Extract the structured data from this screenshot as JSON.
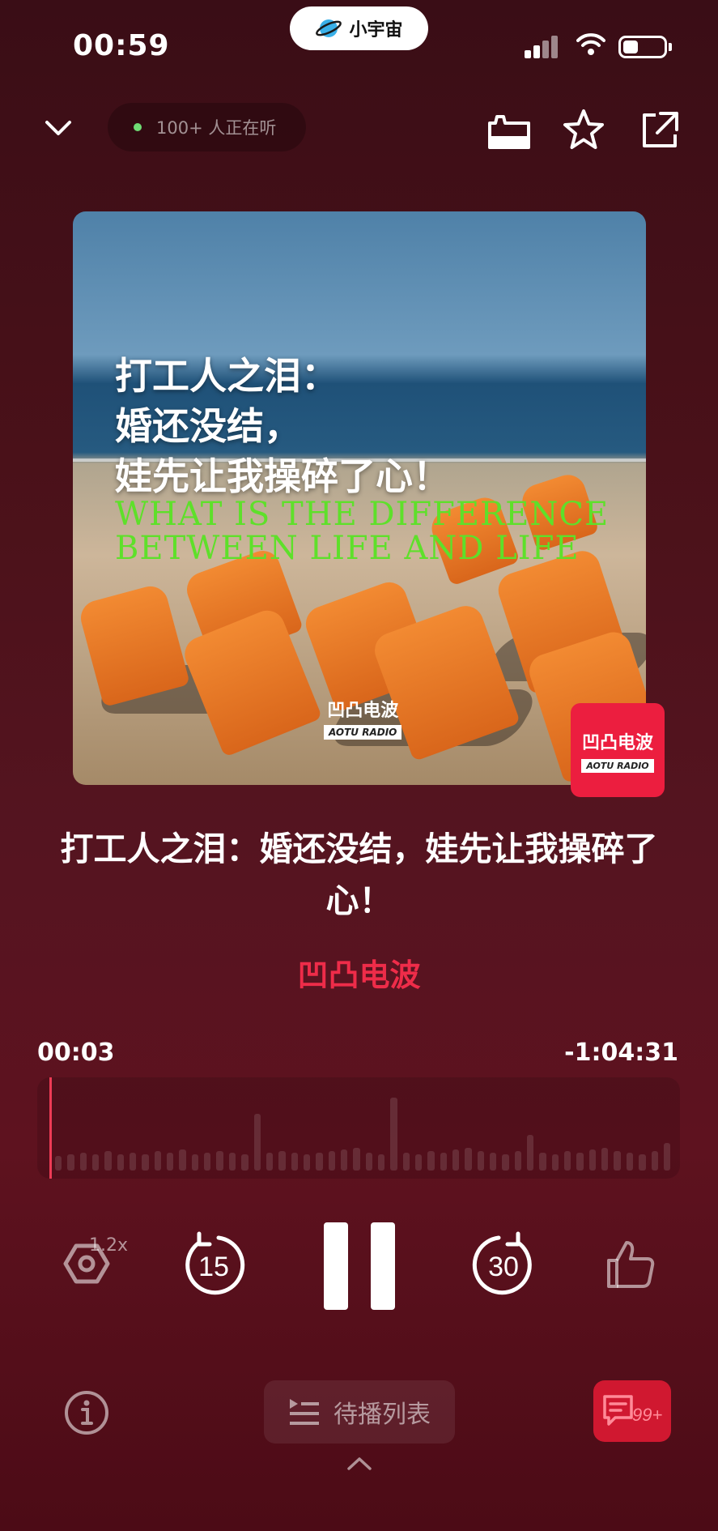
{
  "status_bar": {
    "time": "00:59",
    "app_island_label": "小宇宙",
    "battery_level": 0.3
  },
  "header": {
    "listeners_text": "100+ 人正在听",
    "collapse_icon": "chevron-down-icon",
    "icons": [
      "save-tray-icon",
      "star-icon",
      "share-icon"
    ]
  },
  "cover": {
    "title_lines": [
      "打工人之泪：",
      "婚还没结，",
      "娃先让我操碎了心！"
    ],
    "english_lines": [
      "WHAT IS THE DIFFERENCE",
      "BETWEEN LIFE AND LIFE"
    ],
    "logo_cn": "凹凸电波",
    "logo_en": "AOTU RADIO"
  },
  "badge": {
    "cn": "凹凸电波",
    "en": "AOTU RADIO"
  },
  "episode": {
    "title": "打工人之泪：婚还没结，娃先让我操碎了心！",
    "podcast": "凹凸电波"
  },
  "progress": {
    "current": "00:03",
    "remaining": "-1:04:31"
  },
  "controls": {
    "speed_label": "1.2x",
    "rewind_seconds": "15",
    "forward_seconds": "30",
    "state": "playing"
  },
  "bottom": {
    "queue_label": "待播列表",
    "comment_count": "99+"
  },
  "colors": {
    "accent": "#ee2c49",
    "background": "#4a1119"
  }
}
